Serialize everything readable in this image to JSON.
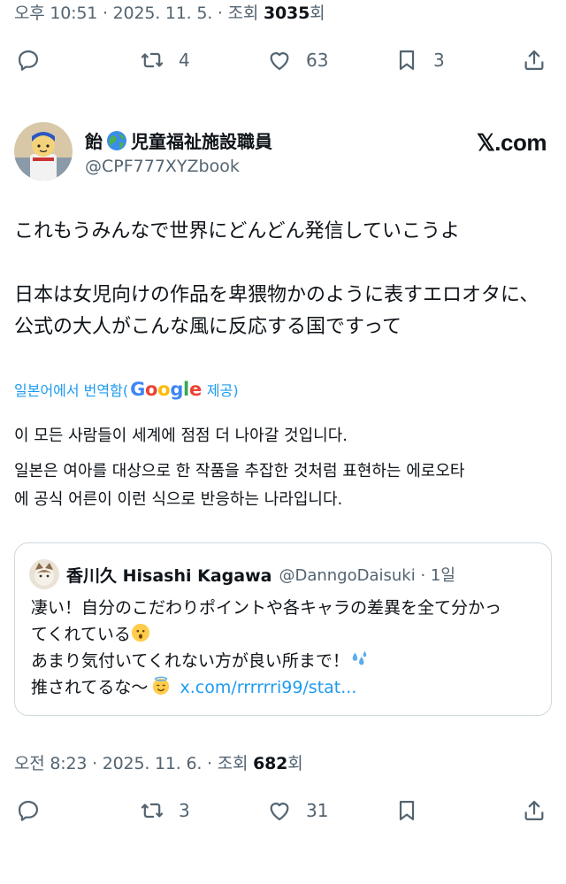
{
  "top_tweet": {
    "meta_prefix": "오후 10:51 · 2025. 11. 5. · 조회 ",
    "views": "3035",
    "views_suffix": "회",
    "retweets": "4",
    "likes": "63",
    "bookmarks": "3"
  },
  "author": {
    "display_name_a": "飴",
    "display_name_b": "児童福祉施設職員",
    "handle": "@CPF777XYZbook",
    "brand": "𝕏.com"
  },
  "post": {
    "line1": "これもうみんなで世界にどんどん発信していこうよ",
    "line2": "日本は女児向けの作品を卑猥物かのように表すエロオタに、",
    "line3": "公式の大人がこんな風に反応する国ですって"
  },
  "translation": {
    "label": "일본어에서 번역함(",
    "brand": "Google",
    "provider": "제공)",
    "line1": "이 모든 사람들이 세계에 점점 더 나아갈 것입니다.",
    "line2": "일본은 여아를 대상으로 한 작품을 추잡한 것처럼 표현하는 에로오타",
    "line3": "에 공식 어른이 이런 식으로 반응하는 나라입니다."
  },
  "quote": {
    "name": "香川久 Hisashi Kagawa",
    "handle": "@DanngoDaisuki · 1일",
    "line1": "凄い！自分のこだわりポイントや各キャラの差異を全て分かっ",
    "line2": "てくれている",
    "line3": "あまり気付いてくれない方が良い所まで！",
    "line4": "推されてるな～",
    "link": "x.com/rrrrrri99/stat..."
  },
  "bottom_tweet": {
    "meta_prefix": "오전 8:23 · 2025. 11. 6. · 조회 ",
    "views": "682",
    "views_suffix": "회",
    "retweets": "3",
    "likes": "31"
  },
  "colors": {
    "accent": "#1d9bf0",
    "muted": "#536471",
    "text": "#0f1419",
    "border": "#cfd9de"
  }
}
